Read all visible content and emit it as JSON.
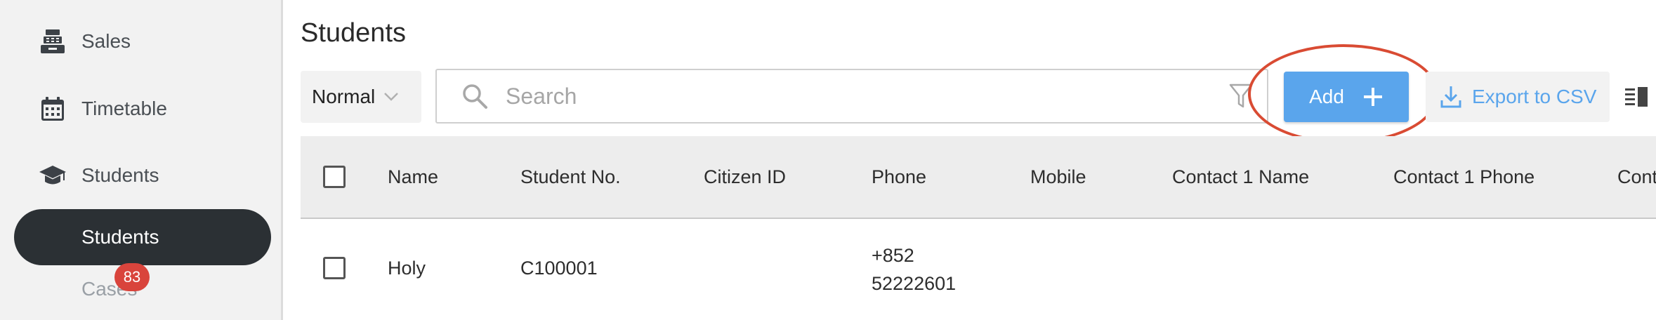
{
  "sidebar": {
    "items": [
      {
        "label": "Sales",
        "icon": "cash-register-icon"
      },
      {
        "label": "Timetable",
        "icon": "calendar-icon"
      },
      {
        "label": "Students",
        "icon": "graduation-cap-icon"
      }
    ],
    "sub_items": [
      {
        "label": "Students",
        "active": true
      },
      {
        "label": "Cases",
        "badge": "83"
      }
    ]
  },
  "main": {
    "title": "Students",
    "mode": "Normal",
    "search_placeholder": "Search",
    "add_label": "Add",
    "export_label": "Export to CSV"
  },
  "table": {
    "columns": [
      "Name",
      "Student No.",
      "Citizen ID",
      "Phone",
      "Mobile",
      "Contact 1 Name",
      "Contact 1 Phone",
      "Cont"
    ],
    "rows": [
      {
        "name": "Holy",
        "student_no": "C100001",
        "citizen_id": "",
        "phone_line1": "+852",
        "phone_line2": "52222601",
        "mobile": "",
        "contact1_name": "",
        "contact1_phone": ""
      }
    ]
  },
  "colors": {
    "accent": "#5aa5ec",
    "sidebar_active": "#2b3034",
    "badge": "#d9443c",
    "highlight": "#d94b33"
  }
}
